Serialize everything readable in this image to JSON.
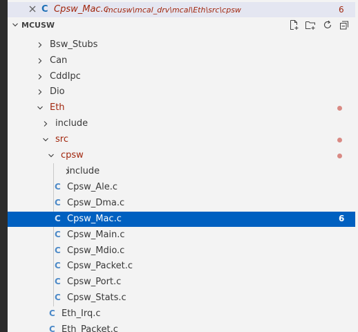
{
  "open_editor": {
    "icon_letter": "C",
    "name": "Cpsw_Mac.c",
    "path": "mcusw\\mcal_drv\\mcal\\Eth\\src\\cpsw",
    "problems": "6"
  },
  "explorer": {
    "section_title": "MCUSW",
    "actions": [
      "new-file-icon",
      "new-folder-icon",
      "refresh-icon",
      "collapse-all-icon"
    ],
    "items": [
      {
        "label": "Bsw_Stubs",
        "type": "folder",
        "expanded": false
      },
      {
        "label": "Can",
        "type": "folder",
        "expanded": false
      },
      {
        "label": "CddIpc",
        "type": "folder",
        "expanded": false
      },
      {
        "label": "Dio",
        "type": "folder",
        "expanded": false
      },
      {
        "label": "Eth",
        "type": "folder",
        "expanded": true,
        "error": true
      },
      {
        "label": "include",
        "type": "folder",
        "expanded": false
      },
      {
        "label": "src",
        "type": "folder",
        "expanded": true,
        "error": true
      },
      {
        "label": "cpsw",
        "type": "folder",
        "expanded": true,
        "error": true
      },
      {
        "label": "include",
        "type": "folder",
        "expanded": false
      },
      {
        "label": "Cpsw_Ale.c",
        "type": "file",
        "icon_letter": "C"
      },
      {
        "label": "Cpsw_Dma.c",
        "type": "file",
        "icon_letter": "C"
      },
      {
        "label": "Cpsw_Mac.c",
        "type": "file",
        "icon_letter": "C",
        "selected": true,
        "problems": "6"
      },
      {
        "label": "Cpsw_Main.c",
        "type": "file",
        "icon_letter": "C"
      },
      {
        "label": "Cpsw_Mdio.c",
        "type": "file",
        "icon_letter": "C"
      },
      {
        "label": "Cpsw_Packet.c",
        "type": "file",
        "icon_letter": "C"
      },
      {
        "label": "Cpsw_Port.c",
        "type": "file",
        "icon_letter": "C"
      },
      {
        "label": "Cpsw_Stats.c",
        "type": "file",
        "icon_letter": "C"
      },
      {
        "label": "Eth_Irq.c",
        "type": "file",
        "icon_letter": "C"
      },
      {
        "label": "Eth_Packet.c",
        "type": "file",
        "icon_letter": "C"
      }
    ]
  },
  "colors": {
    "selection": "#0060c0",
    "error_text": "#a1260d",
    "error_dot": "#d98a84",
    "c_icon": "#4d8ac8"
  }
}
